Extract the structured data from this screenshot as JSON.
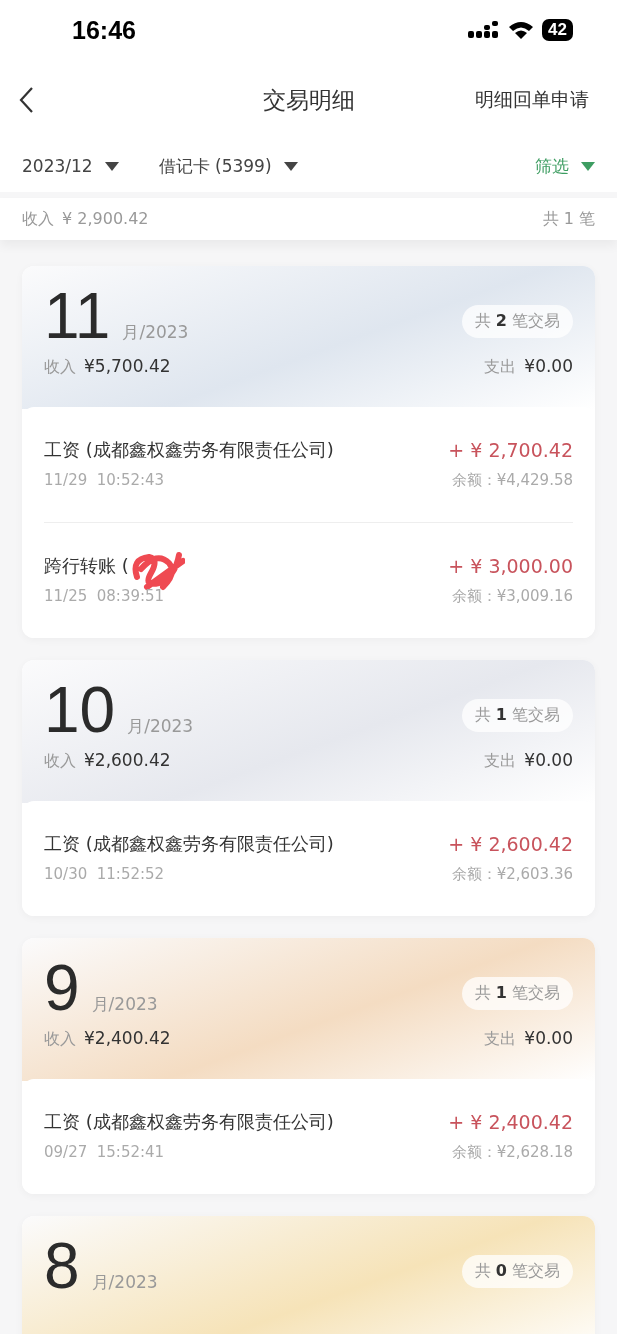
{
  "status_bar": {
    "time": "16:46",
    "battery": "42"
  },
  "nav": {
    "title": "交易明细",
    "action": "明细回单申请"
  },
  "filters": {
    "month": "2023/12",
    "card": "借记卡 (5399)",
    "filter": "筛选"
  },
  "summary": {
    "income_label": "收入",
    "income": "¥ 2,900.42",
    "count": "共 1 笔"
  },
  "months": [
    {
      "month": "11",
      "year": "月/2023",
      "count": "共 **2** 笔交易",
      "color": "#dfe6ef",
      "income_label": "收入",
      "income": "¥5,700.42",
      "expense_label": "支出",
      "expense": "¥0.00",
      "transactions": [
        {
          "name": "工资 (成都鑫权鑫劳务有限责任公司)",
          "time": "11/29  10:52:43",
          "amount": "+ ¥ 2,700.42",
          "balance": "余额：¥4,429.58",
          "redacted": false
        },
        {
          "name": "跨行转账 (",
          "time": "11/25  08:39:51",
          "amount": "+ ¥ 3,000.00",
          "balance": "余额：¥3,009.16",
          "redacted": true
        }
      ]
    },
    {
      "month": "10",
      "year": "月/2023",
      "count": "共 **1** 笔交易",
      "color": "#e6e8ee",
      "income_label": "收入",
      "income": "¥2,600.42",
      "expense_label": "支出",
      "expense": "¥0.00",
      "transactions": [
        {
          "name": "工资 (成都鑫权鑫劳务有限责任公司)",
          "time": "10/30  11:52:52",
          "amount": "+ ¥ 2,600.42",
          "balance": "余额：¥2,603.36",
          "redacted": false
        }
      ]
    },
    {
      "month": "9",
      "year": "月/2023",
      "count": "共 **1** 笔交易",
      "color": "#f4dcc2",
      "income_label": "收入",
      "income": "¥2,400.42",
      "expense_label": "支出",
      "expense": "¥0.00",
      "transactions": [
        {
          "name": "工资 (成都鑫权鑫劳务有限责任公司)",
          "time": "09/27  15:52:41",
          "amount": "+ ¥ 2,400.42",
          "balance": "余额：¥2,628.18",
          "redacted": false
        }
      ]
    },
    {
      "month": "8",
      "year": "月/2023",
      "count": "共 **0** 笔交易",
      "color": "#f6e3b8"
    }
  ]
}
